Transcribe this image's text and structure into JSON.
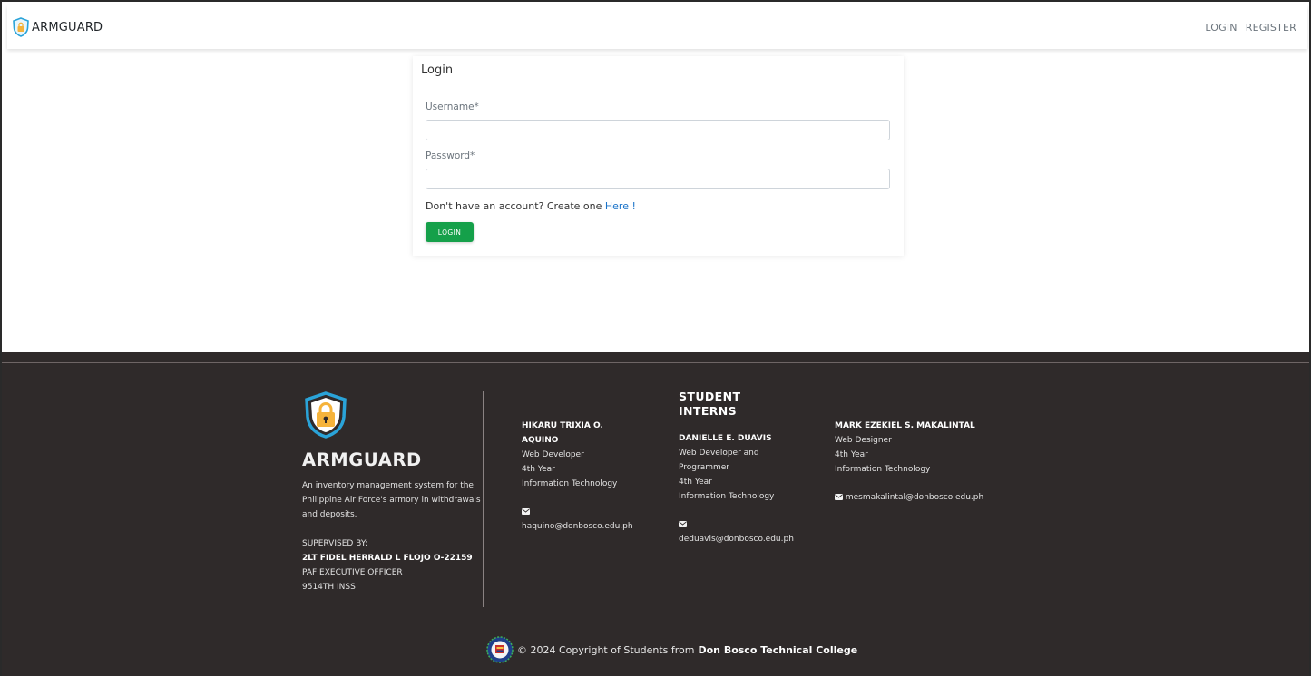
{
  "navbar": {
    "brand": "ARMGUARD",
    "links": [
      "LOGIN",
      "REGISTER"
    ]
  },
  "login": {
    "title": "Login",
    "username_label": "Username*",
    "username_value": "",
    "password_label": "Password*",
    "password_value": "",
    "signup_prefix": "Don't have an account? Create one",
    "signup_link": "Here",
    "signup_suffix": "!",
    "button": "LOGIN",
    "button_color": "#15a04a"
  },
  "footer": {
    "brand": "ARMGUARD",
    "description": "An inventory management system for the Philippine Air Force's armory in withdrawals and deposits.",
    "supervised_label": "SUPERVISED BY:",
    "supervisor_name": "2LT FIDEL HERRALD L FLOJO O-22159",
    "supervisor_role": "PAF EXECUTIVE OFFICER",
    "supervisor_unit": "9514TH INSS",
    "interns_heading": "STUDENT INTERNS",
    "interns": [
      {
        "name": "HIKARU TRIXIA O. AQUINO",
        "role": "Web Developer",
        "year": "4th Year",
        "program": "Information Technology",
        "email": "haquino@donbosco.edu.ph"
      },
      {
        "name": "DANIELLE E. DUAVIS",
        "role": "Web Developer and Programmer",
        "year": "4th Year",
        "program": "Information Technology",
        "email": "deduavis@donbosco.edu.ph"
      },
      {
        "name": "MARK EZEKIEL S. MAKALINTAL",
        "role": "Web Designer",
        "year": "4th Year",
        "program": "Information Technology",
        "email": "mesmakalintal@donbosco.edu.ph"
      }
    ],
    "copyright_text": "© 2024 Copyright of Students from",
    "copyright_org": "Don Bosco Technical College",
    "background_color": "#2f2a2a"
  },
  "icons": {
    "brand": "shield-lock-icon",
    "email": "envelope-icon",
    "seal": "college-seal-icon"
  }
}
